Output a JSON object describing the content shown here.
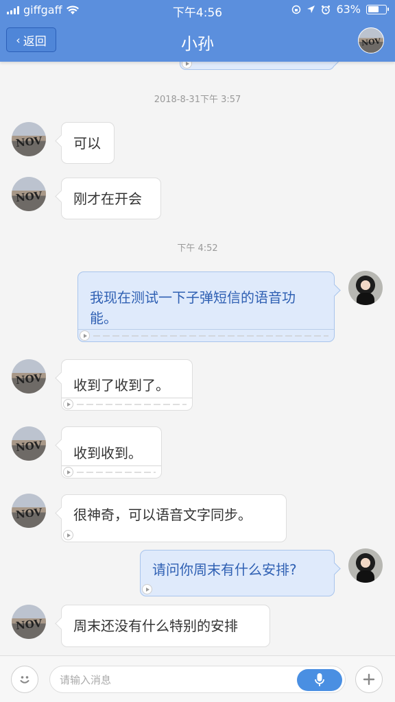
{
  "status_bar": {
    "carrier": "giffgaff",
    "time": "下午4:56",
    "battery": "63%",
    "battery_level": 0.63
  },
  "nav": {
    "back_label": "返回",
    "title": "小孙"
  },
  "timestamps": {
    "first": "2018-8-31下午 3:57",
    "second": "下午 4:52"
  },
  "messages": [
    {
      "from": "other",
      "text": "可以"
    },
    {
      "from": "other",
      "text": "刚才在开会"
    },
    {
      "from": "self",
      "line1": "我现在测试一下子弹短信的语音功",
      "line2": "能。",
      "voice": true
    },
    {
      "from": "other",
      "text": "收到了收到了。",
      "voice": true
    },
    {
      "from": "other",
      "text": "收到收到。",
      "voice": true
    },
    {
      "from": "other",
      "text": "很神奇，可以语音文字同步。",
      "voice": true
    },
    {
      "from": "self",
      "text": "请问你周末有什么安排?",
      "voice": true
    },
    {
      "from": "other",
      "text": "周末还没有什么特别的安排"
    }
  ],
  "avatar_text": "NOV",
  "input": {
    "placeholder": "请输入消息"
  },
  "icons": {
    "emoji": "smiley-icon",
    "mic": "microphone-icon",
    "more": "plus-icon"
  }
}
